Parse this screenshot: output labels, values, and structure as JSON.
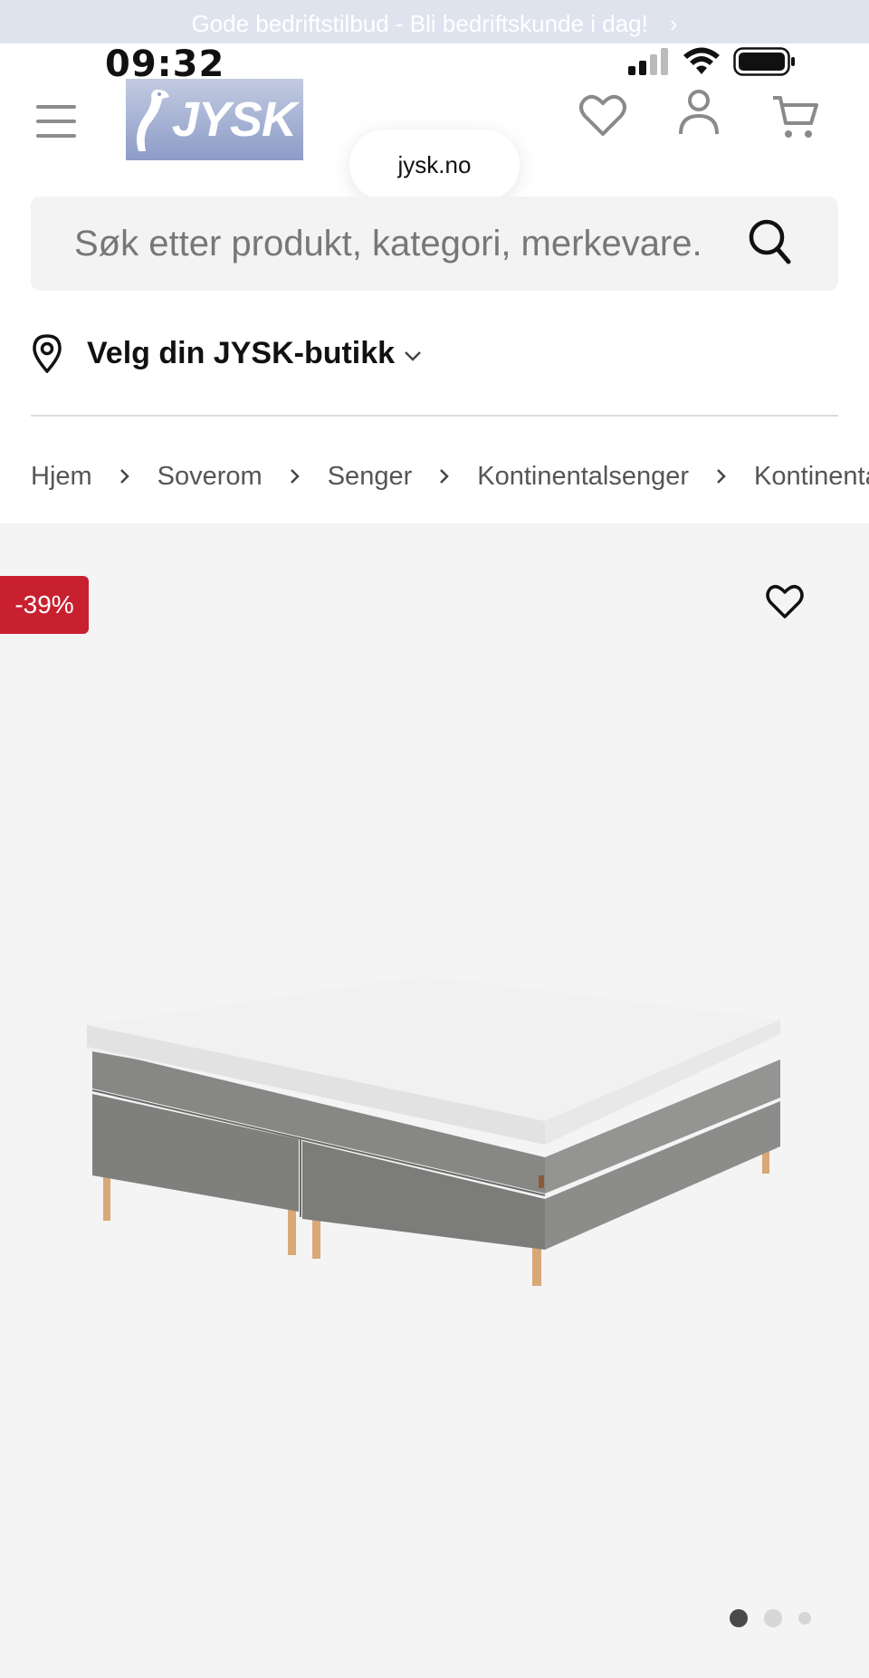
{
  "promo": {
    "text": "Gode bedriftstilbud - Bli bedriftskunde i dag!",
    "arrow": "›"
  },
  "status_bar": {
    "time": "09:32"
  },
  "header": {
    "logo_text": "JYSK",
    "url": "jysk.no",
    "icons": [
      "menu-icon",
      "heart-icon",
      "user-icon",
      "cart-icon"
    ]
  },
  "search": {
    "placeholder": "Søk etter produkt, kategori, merkevare."
  },
  "store": {
    "label": "Velg din JYSK-butikk"
  },
  "breadcrumb": [
    "Hjem",
    "Soverom",
    "Senger",
    "Kontinentalsenger",
    "Kontinentalseng"
  ],
  "product": {
    "discount": "-39%",
    "gallery_slide": 1,
    "gallery_total": 3
  },
  "colors": {
    "discount_red": "#c8202f",
    "logo_blue": "#8c9cc8"
  }
}
